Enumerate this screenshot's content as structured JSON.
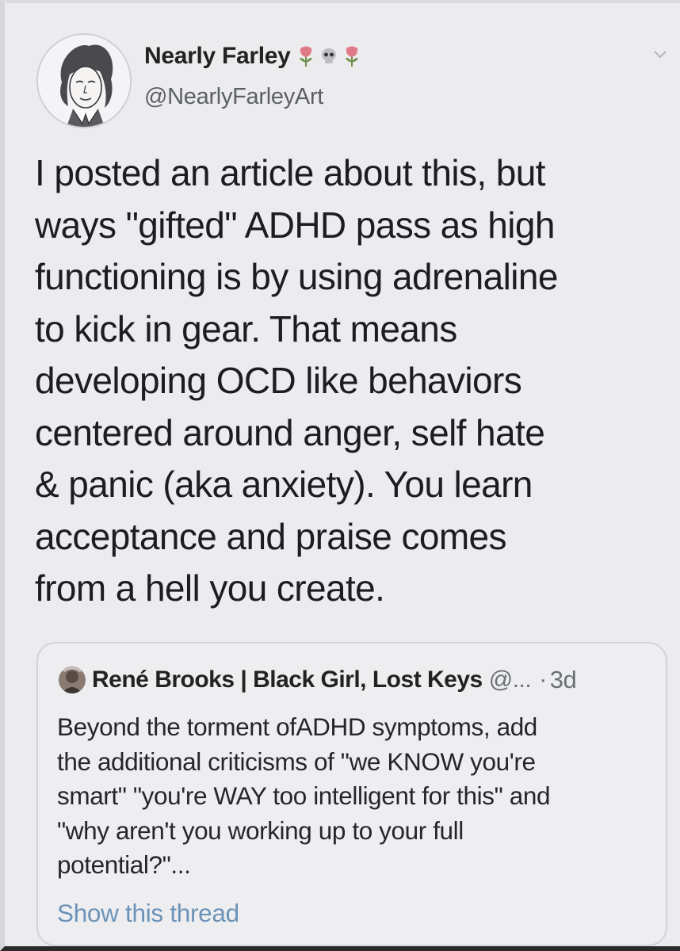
{
  "tweet": {
    "author": {
      "name": "Nearly Farley",
      "name_emoji": [
        "rose-emoji",
        "skull-emoji",
        "rose-emoji"
      ],
      "handle": "@NearlyFarleyArt"
    },
    "menu_icon": "chevron-down-icon",
    "text_lines": [
      "I posted an article about this, but",
      "ways \"gifted\" ADHD pass as high",
      "functioning is by using adrenaline",
      "to kick in gear. That means",
      "developing OCD like behaviors",
      "centered around anger, self hate",
      "& panic (aka anxiety). You learn",
      "acceptance and praise comes",
      "from a hell you create."
    ]
  },
  "quoted_tweet": {
    "author_name": "René Brooks | Black Girl, Lost Keys",
    "handle": "@...",
    "separator": "·",
    "time": "3d",
    "text_lines": [
      "Beyond the torment ofADHD symptoms, add",
      "the additional criticisms of \"we KNOW you're",
      "smart\" \"you're WAY too intelligent for this\" and",
      "\"why aren't you working up to your full",
      "potential?\"..."
    ],
    "show_thread": "Show this thread"
  },
  "colors": {
    "background": "#ececef",
    "link": "#6b93b8",
    "secondary_text": "#5b5f66",
    "rose": "#e07a86",
    "stem": "#6c8f4a"
  }
}
